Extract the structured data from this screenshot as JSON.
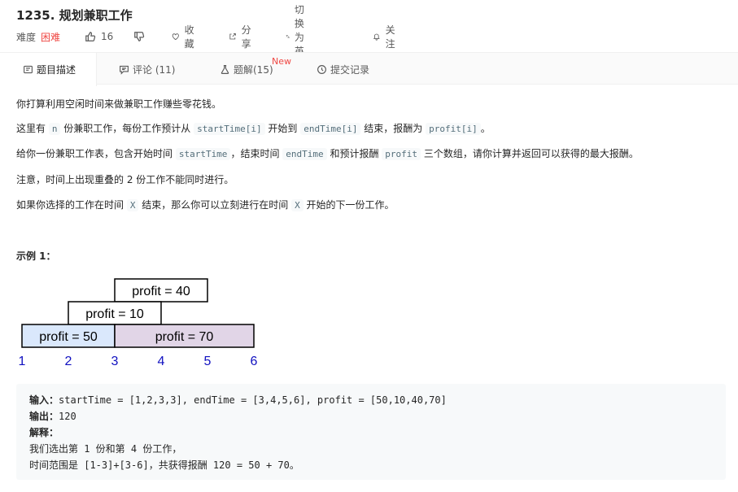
{
  "problem": {
    "title": "1235. 规划兼职工作",
    "difficulty_label": "难度",
    "difficulty": "困难",
    "likes": "16",
    "favorite_label": "收藏",
    "share_label": "分享",
    "translate_label": "切换为英文",
    "follow_label": "关注"
  },
  "tabs": [
    {
      "label": "题目描述"
    },
    {
      "label": "评论 (11)"
    },
    {
      "label": "题解(15)",
      "badge": "New"
    },
    {
      "label": "提交记录"
    }
  ],
  "description": {
    "p1": "你打算利用空闲时间来做兼职工作赚些零花钱。",
    "p2": [
      "这里有 ",
      "n",
      " 份兼职工作，每份工作预计从 ",
      "startTime[i]",
      " 开始到 ",
      "endTime[i]",
      " 结束，报酬为 ",
      "profit[i]",
      "。"
    ],
    "p3": [
      "给你一份兼职工作表，包含开始时间 ",
      "startTime",
      "，结束时间 ",
      "endTime",
      " 和预计报酬 ",
      "profit",
      " 三个数组，请你计算并返回可以获得的最大报酬。"
    ],
    "p4": "注意，时间上出现重叠的 2 份工作不能同时进行。",
    "p5": [
      "如果你选择的工作在时间 ",
      "X",
      " 结束，那么你可以立刻进行在时间 ",
      "X",
      " 开始的下一份工作。"
    ]
  },
  "example": {
    "title": "示例 1：",
    "diagram": {
      "jobs": [
        {
          "label": "profit = 40",
          "start": 3,
          "end": 5,
          "row": 3,
          "fill": "#ffffff"
        },
        {
          "label": "profit = 10",
          "start": 2,
          "end": 4,
          "row": 2,
          "fill": "#ffffff"
        },
        {
          "label": "profit = 50",
          "start": 1,
          "end": 3,
          "row": 1,
          "fill": "#dae8fc"
        },
        {
          "label": "profit = 70",
          "start": 3,
          "end": 6,
          "row": 1,
          "fill": "#e1d5e7"
        }
      ],
      "ticks": [
        "1",
        "2",
        "3",
        "4",
        "5",
        "6"
      ],
      "tick_color": "#1010c0"
    },
    "input_label": "输入：",
    "input": "startTime = [1,2,3,3], endTime = [3,4,5,6], profit = [50,10,40,70]",
    "output_label": "输出：",
    "output": "120",
    "explain_label": "解释：",
    "explain_line1": "我们选出第 1 份和第 4 份工作，",
    "explain_line2": "时间范围是 [1-3]+[3-6]，共获得报酬 120 = 50 + 70。"
  }
}
